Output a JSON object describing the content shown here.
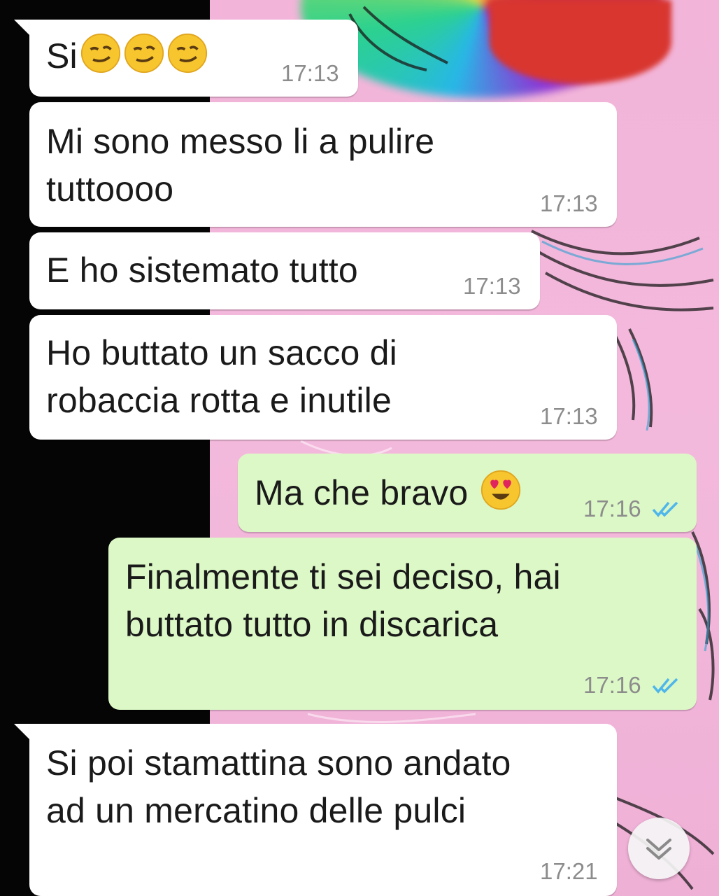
{
  "messages": [
    {
      "id": "m1",
      "direction": "incoming",
      "text": "Si",
      "emoji": "smirking-face",
      "emoji_count": 3,
      "time": "17:13"
    },
    {
      "id": "m2",
      "direction": "incoming",
      "text": "Mi sono messo li a pulire\ntuttoooo",
      "time": "17:13"
    },
    {
      "id": "m3",
      "direction": "incoming",
      "text": "E ho sistemato tutto",
      "time": "17:13"
    },
    {
      "id": "m4",
      "direction": "incoming",
      "text": "Ho buttato un sacco di\nrobaccia rotta e inutile",
      "time": "17:13"
    },
    {
      "id": "m5",
      "direction": "outgoing",
      "text": "Ma che bravo",
      "emoji": "heart-eyes-face",
      "time": "17:16",
      "status": "read"
    },
    {
      "id": "m6",
      "direction": "outgoing",
      "text": "Finalmente ti sei deciso, hai\nbuttato tutto in discarica",
      "time": "17:16",
      "status": "read"
    },
    {
      "id": "m7",
      "direction": "incoming",
      "text": "Si poi stamattina sono andato\nad un mercatino delle pulci",
      "time": "17:21"
    }
  ],
  "colors": {
    "incoming_bubble": "#ffffff",
    "outgoing_bubble": "#dcf8c6",
    "timestamp": "#8c8c8c",
    "read_ticks": "#4fb6ec"
  },
  "scroll_button": {
    "icon": "double-chevron-down-icon"
  }
}
